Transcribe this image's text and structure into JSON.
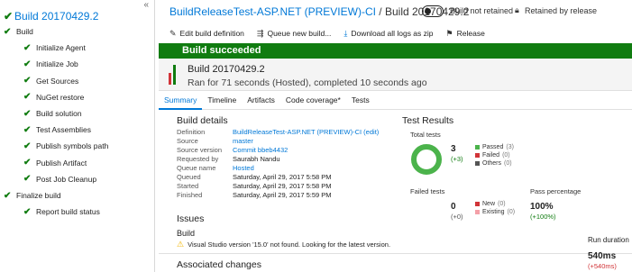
{
  "sidebar": {
    "title": "Build 20170429.2",
    "collapse_glyph": "«",
    "steps": [
      {
        "label": "Build",
        "level": 0
      },
      {
        "label": "Initialize Agent",
        "level": 1
      },
      {
        "label": "Initialize Job",
        "level": 1
      },
      {
        "label": "Get Sources",
        "level": 1
      },
      {
        "label": "NuGet restore",
        "level": 1
      },
      {
        "label": "Build solution",
        "level": 1
      },
      {
        "label": "Test Assemblies",
        "level": 1
      },
      {
        "label": "Publish symbols path",
        "level": 1
      },
      {
        "label": "Publish Artifact",
        "level": 1
      },
      {
        "label": "Post Job Cleanup",
        "level": 1
      },
      {
        "label": "Finalize build",
        "level": 0
      },
      {
        "label": "Report build status",
        "level": 1
      }
    ]
  },
  "header": {
    "definition_link": "BuildReleaseTest-ASP.NET (PREVIEW)-CI",
    "separator": " / ",
    "build_name": "Build 20170429.2",
    "retain_toggle_label": "Build not retained",
    "retained_by_release": "Retained by release"
  },
  "toolbar": {
    "edit": "Edit build definition",
    "queue": "Queue new build...",
    "download": "Download all logs as zip",
    "release": "Release"
  },
  "banner": {
    "text": "Build succeeded",
    "color": "#107c10"
  },
  "summary": {
    "build_number": "Build 20170429.2",
    "description": "Ran for 71 seconds (Hosted), completed 10 seconds ago",
    "history_bars": [
      {
        "status": "failed",
        "level": 0.6,
        "color": "#d13438"
      },
      {
        "status": "succeeded",
        "level": 1.0,
        "color": "#107c10"
      }
    ]
  },
  "tabs": [
    {
      "label": "Summary",
      "active": true
    },
    {
      "label": "Timeline",
      "active": false
    },
    {
      "label": "Artifacts",
      "active": false
    },
    {
      "label": "Code coverage*",
      "active": false
    },
    {
      "label": "Tests",
      "active": false
    }
  ],
  "build_details": {
    "heading": "Build details",
    "rows": [
      {
        "key": "Definition",
        "value": "BuildReleaseTest-ASP.NET (PREVIEW)-CI (edit)",
        "link": true
      },
      {
        "key": "Source",
        "value": "master",
        "link": true
      },
      {
        "key": "Source version",
        "value": "Commit bbeb4432",
        "link": true
      },
      {
        "key": "Requested by",
        "value": "Saurabh Nandu",
        "link": false
      },
      {
        "key": "Queue name",
        "value": "Hosted",
        "link": true
      },
      {
        "key": "Queued",
        "value": "Saturday, April 29, 2017 5:58 PM",
        "link": false
      },
      {
        "key": "Started",
        "value": "Saturday, April 29, 2017 5:58 PM",
        "link": false
      },
      {
        "key": "Finished",
        "value": "Saturday, April 29, 2017 5:59 PM",
        "link": false
      }
    ]
  },
  "issues": {
    "heading": "Issues",
    "group": "Build",
    "warning": "Visual Studio version '15.0' not found. Looking for the latest version."
  },
  "associated_changes": {
    "heading": "Associated changes"
  },
  "test_results": {
    "heading": "Test Results",
    "total_label": "Total tests",
    "total": "3",
    "total_delta": "(+3)",
    "legend": [
      {
        "label": "Passed",
        "count": "(3)",
        "color": "#4bb34b"
      },
      {
        "label": "Failed",
        "count": "(0)",
        "color": "#d13438"
      },
      {
        "label": "Others",
        "count": "(0)",
        "color": "#555555"
      }
    ],
    "failed_label": "Failed tests",
    "failed": "0",
    "failed_delta": "(+0)",
    "failed_legend": [
      {
        "label": "New",
        "count": "(0)",
        "color": "#d13438"
      },
      {
        "label": "Existing",
        "count": "(0)",
        "color": "#f4a0a8"
      }
    ],
    "pass_pct_label": "Pass percentage",
    "pass_pct": "100%",
    "pass_pct_delta": "(+100%)",
    "run_duration_label": "Run duration",
    "run_duration": "540ms",
    "run_duration_delta": "(+540ms)"
  }
}
